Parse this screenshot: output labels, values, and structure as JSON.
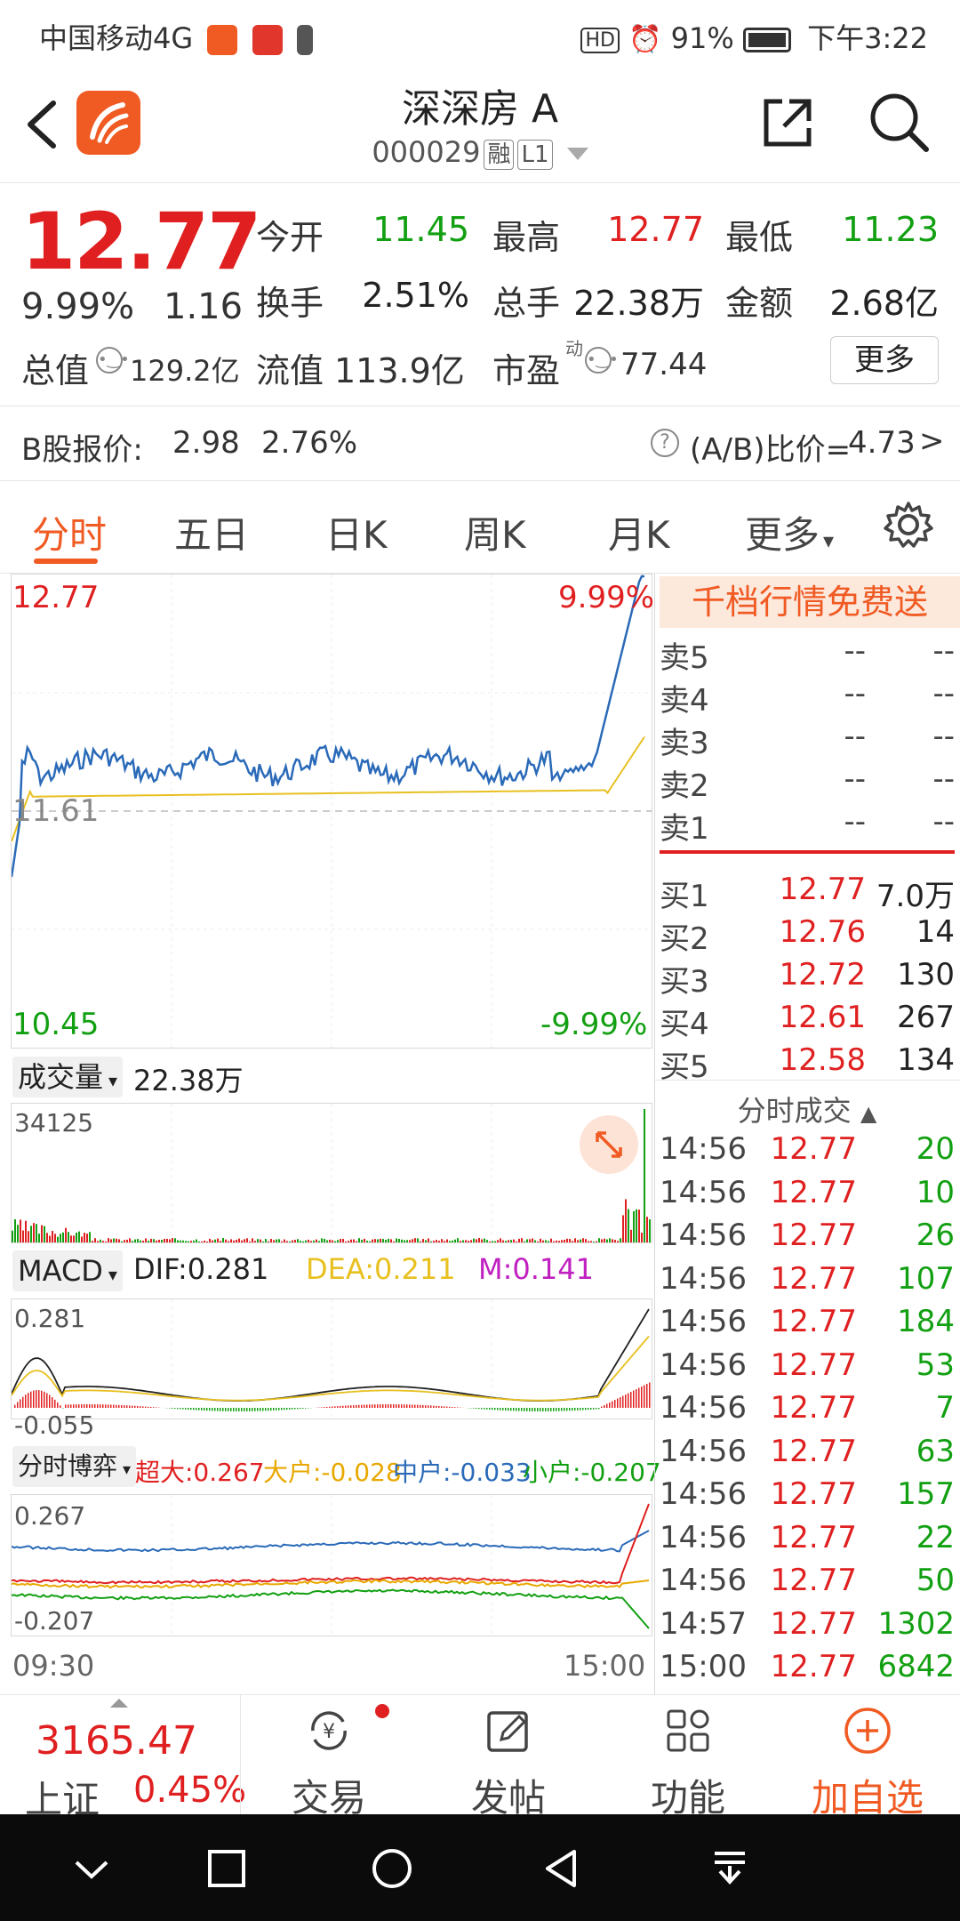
{
  "status_bar": {
    "carrier": "中国移动4G",
    "battery": "91%",
    "time": "下午3:22",
    "hd": "HD"
  },
  "header": {
    "stock_name": "深深房 A",
    "stock_code": "000029",
    "tag_rong": "融",
    "tag_level": "L1"
  },
  "quote": {
    "price": "12.77",
    "change_pct": "9.99%",
    "change": "1.16",
    "open_label": "今开",
    "open": "11.45",
    "high_label": "最高",
    "high": "12.77",
    "low_label": "最低",
    "low": "11.23",
    "turnover_label": "换手",
    "turnover": "2.51%",
    "volume_label": "总手",
    "volume": "22.38万",
    "amount_label": "金额",
    "amount": "2.68亿",
    "mktcap_label": "总值",
    "mktcap": "129.2亿",
    "float_label": "流值",
    "float_cap": "113.9亿",
    "pe_label": "市盈",
    "pe_sup": "动",
    "pe": "77.44",
    "more_button": "更多"
  },
  "bshare": {
    "label": "B股报价:",
    "price": "2.98",
    "pct": "2.76%",
    "ratio_label": "(A/B)比价=",
    "ratio": "4.73"
  },
  "tabs": [
    "分时",
    "五日",
    "日K",
    "周K",
    "月K",
    "更多"
  ],
  "intraday": {
    "top_price": "12.77",
    "top_pct": "9.99%",
    "mid_price": "11.61",
    "bottom_price": "10.45",
    "bottom_pct": "-9.99%"
  },
  "volume_panel": {
    "selector": "成交量",
    "total": "22.38万",
    "max": "34125"
  },
  "macd_panel": {
    "selector": "MACD",
    "dif": "DIF:0.281",
    "dea": "DEA:0.211",
    "m": "M:0.141",
    "top": "0.281",
    "bottom": "-0.055"
  },
  "game_panel": {
    "selector": "分时博弈",
    "super": "超大:0.267",
    "big": "大户:-0.028",
    "mid": "中户:-0.033",
    "small": "小户:-0.207",
    "top": "0.267",
    "bottom": "-0.207"
  },
  "time_axis": {
    "start": "09:30",
    "end": "15:00"
  },
  "orderbook": {
    "promo": "千档行情免费送",
    "asks": [
      {
        "label": "卖5",
        "price": "--",
        "vol": "--"
      },
      {
        "label": "卖4",
        "price": "--",
        "vol": "--"
      },
      {
        "label": "卖3",
        "price": "--",
        "vol": "--"
      },
      {
        "label": "卖2",
        "price": "--",
        "vol": "--"
      },
      {
        "label": "卖1",
        "price": "--",
        "vol": "--"
      }
    ],
    "bids": [
      {
        "label": "买1",
        "price": "12.77",
        "vol": "7.0万"
      },
      {
        "label": "买2",
        "price": "12.76",
        "vol": "14"
      },
      {
        "label": "买3",
        "price": "12.72",
        "vol": "130"
      },
      {
        "label": "买4",
        "price": "12.61",
        "vol": "267"
      },
      {
        "label": "买5",
        "price": "12.58",
        "vol": "134"
      }
    ]
  },
  "ticks": {
    "title": "分时成交",
    "rows": [
      {
        "time": "14:56",
        "price": "12.77",
        "vol": "20"
      },
      {
        "time": "14:56",
        "price": "12.77",
        "vol": "10"
      },
      {
        "time": "14:56",
        "price": "12.77",
        "vol": "26"
      },
      {
        "time": "14:56",
        "price": "12.77",
        "vol": "107"
      },
      {
        "time": "14:56",
        "price": "12.77",
        "vol": "184"
      },
      {
        "time": "14:56",
        "price": "12.77",
        "vol": "53"
      },
      {
        "time": "14:56",
        "price": "12.77",
        "vol": "7"
      },
      {
        "time": "14:56",
        "price": "12.77",
        "vol": "63"
      },
      {
        "time": "14:56",
        "price": "12.77",
        "vol": "157"
      },
      {
        "time": "14:56",
        "price": "12.77",
        "vol": "22"
      },
      {
        "time": "14:56",
        "price": "12.77",
        "vol": "50"
      },
      {
        "time": "14:57",
        "price": "12.77",
        "vol": "1302"
      },
      {
        "time": "15:00",
        "price": "12.77",
        "vol": "6842"
      }
    ]
  },
  "bottom_bar": {
    "index_value": "3165.47",
    "index_name": "上证",
    "index_pct": "0.45%",
    "trade": "交易",
    "post": "发帖",
    "function": "功能",
    "add": "加自选"
  },
  "colors": {
    "up": "#e02020",
    "down": "#12a012",
    "accent": "#f05a23",
    "price_line": "#2a6ab8",
    "avg_line": "#e8c020"
  }
}
